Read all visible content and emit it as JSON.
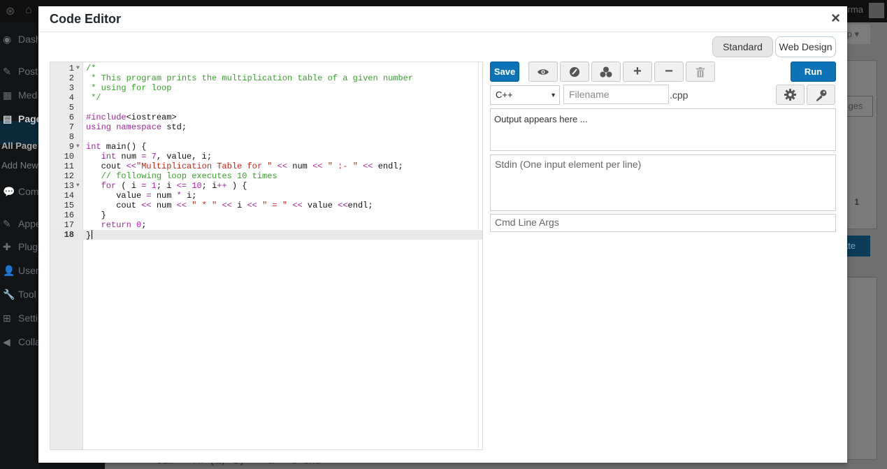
{
  "background": {
    "user_name": "...Kumar...urma",
    "help_label": "lp ▾",
    "pages_button": "ges",
    "update_button": "ate",
    "count_text": "1",
    "sidebar": [
      {
        "glyph": "◉",
        "label": "Dash"
      },
      {
        "glyph": "✎",
        "label": "Post"
      },
      {
        "glyph": "▦",
        "label": "Med"
      },
      {
        "glyph": "▤",
        "label": "Page"
      },
      {
        "glyph": "💬",
        "label": "Com"
      },
      {
        "glyph": "✎",
        "label": "Appe"
      },
      {
        "glyph": "✚",
        "label": "Plug"
      },
      {
        "glyph": "👤",
        "label": "User"
      },
      {
        "glyph": "🔧",
        "label": "Tool"
      },
      {
        "glyph": "⊞",
        "label": "Setti"
      },
      {
        "glyph": "◀",
        "label": "Colla"
      }
    ],
    "sidebar_sub": [
      "All Page",
      "Add New"
    ],
    "bottom_code": "sum = fn (a, b) -> a + b end"
  },
  "modal": {
    "title": "Code Editor",
    "close_glyph": "×",
    "modes": {
      "standard": "Standard",
      "web_design": "Web Design"
    }
  },
  "editor": {
    "active_line": 18,
    "lines": [
      [
        [
          "c-comment",
          "/*"
        ]
      ],
      [
        [
          "c-comment",
          " * This program prints the multiplication table of a given number"
        ]
      ],
      [
        [
          "c-comment",
          " * using for loop"
        ]
      ],
      [
        [
          "c-comment",
          " */"
        ]
      ],
      [],
      [
        [
          "c-kw",
          "#include"
        ],
        [
          "",
          "<iostream>"
        ]
      ],
      [
        [
          "c-kw",
          "using"
        ],
        [
          "",
          " "
        ],
        [
          "c-kw",
          "namespace"
        ],
        [
          "",
          " std;"
        ]
      ],
      [],
      [
        [
          "c-kw",
          "int"
        ],
        [
          "",
          " main() {"
        ]
      ],
      [
        [
          "",
          "   "
        ],
        [
          "c-kw",
          "int"
        ],
        [
          "",
          " num "
        ],
        [
          "c-op",
          "="
        ],
        [
          "",
          " "
        ],
        [
          "c-num",
          "7"
        ],
        [
          "",
          ", value, i;"
        ]
      ],
      [
        [
          "",
          "   cout "
        ],
        [
          "c-op",
          "<<"
        ],
        [
          "c-str",
          "\"Multiplication Table for \""
        ],
        [
          "",
          " "
        ],
        [
          "c-op",
          "<<"
        ],
        [
          "",
          " num "
        ],
        [
          "c-op",
          "<<"
        ],
        [
          "",
          " "
        ],
        [
          "c-str",
          "\" :- \""
        ],
        [
          "",
          " "
        ],
        [
          "c-op",
          "<<"
        ],
        [
          "",
          " endl;"
        ]
      ],
      [
        [
          "",
          "   "
        ],
        [
          "c-comment",
          "// following loop executes 10 times"
        ]
      ],
      [
        [
          "",
          "   "
        ],
        [
          "c-kw",
          "for"
        ],
        [
          "",
          " ( i "
        ],
        [
          "c-op",
          "="
        ],
        [
          "",
          " "
        ],
        [
          "c-num",
          "1"
        ],
        [
          "",
          "; i "
        ],
        [
          "c-op",
          "<="
        ],
        [
          "",
          " "
        ],
        [
          "c-num",
          "10"
        ],
        [
          "",
          "; i"
        ],
        [
          "c-op",
          "++"
        ],
        [
          "",
          " ) {"
        ]
      ],
      [
        [
          "",
          "      value "
        ],
        [
          "c-op",
          "="
        ],
        [
          "",
          " num "
        ],
        [
          "c-op",
          "*"
        ],
        [
          "",
          " i;"
        ]
      ],
      [
        [
          "",
          "      cout "
        ],
        [
          "c-op",
          "<<"
        ],
        [
          "",
          " num "
        ],
        [
          "c-op",
          "<<"
        ],
        [
          "",
          " "
        ],
        [
          "c-str",
          "\" * \""
        ],
        [
          "",
          " "
        ],
        [
          "c-op",
          "<<"
        ],
        [
          "",
          " i "
        ],
        [
          "c-op",
          "<<"
        ],
        [
          "",
          " "
        ],
        [
          "c-str",
          "\" = \""
        ],
        [
          "",
          " "
        ],
        [
          "c-op",
          "<<"
        ],
        [
          "",
          " value "
        ],
        [
          "c-op",
          "<<"
        ],
        [
          "",
          "endl;"
        ]
      ],
      [
        [
          "",
          "   }"
        ]
      ],
      [
        [
          "",
          "   "
        ],
        [
          "c-kw",
          "return"
        ],
        [
          "",
          " "
        ],
        [
          "c-num",
          "0"
        ],
        [
          "",
          ";"
        ]
      ],
      [
        [
          "",
          "}"
        ]
      ]
    ],
    "fold_lines": [
      1,
      9,
      13
    ]
  },
  "toolbar": {
    "save_label": "Save",
    "run_label": "Run"
  },
  "language": {
    "selected": "C++"
  },
  "filename": {
    "placeholder": "Filename",
    "extension": ".cpp"
  },
  "output": {
    "text": "Output appears here ..."
  },
  "stdin": {
    "placeholder": "Stdin (One input element per line)"
  },
  "cmd_args": {
    "placeholder": "Cmd Line Args"
  },
  "colors": {
    "primary": "#0d73b7",
    "comment": "#3aa02e",
    "keyword": "#a0289a",
    "string": "#c5261b",
    "number": "#c41ab8"
  }
}
